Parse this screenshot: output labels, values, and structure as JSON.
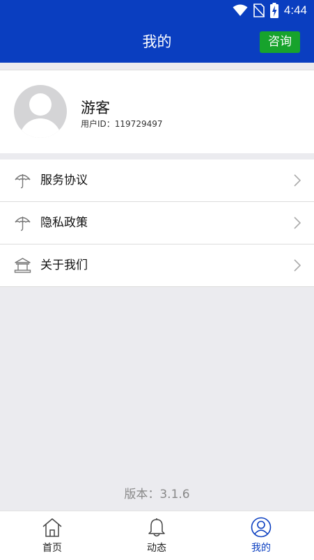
{
  "status_bar": {
    "time": "4:44"
  },
  "header": {
    "title": "我的",
    "consult_label": "咨询"
  },
  "profile": {
    "name": "游客",
    "user_id": "用户ID：119729497"
  },
  "menu": {
    "items": [
      {
        "label": "服务协议",
        "icon": "umbrella-icon"
      },
      {
        "label": "隐私政策",
        "icon": "umbrella-icon"
      },
      {
        "label": "关于我们",
        "icon": "bank-icon"
      }
    ]
  },
  "footer": {
    "version": "版本：3.1.6"
  },
  "tabbar": {
    "tabs": [
      {
        "label": "首页",
        "icon": "home-icon"
      },
      {
        "label": "动态",
        "icon": "bell-icon"
      },
      {
        "label": "我的",
        "icon": "user-icon",
        "active": true
      }
    ]
  },
  "colors": {
    "primary": "#0a3ec0",
    "consult_green": "#17a32c",
    "background": "#ebebef"
  }
}
